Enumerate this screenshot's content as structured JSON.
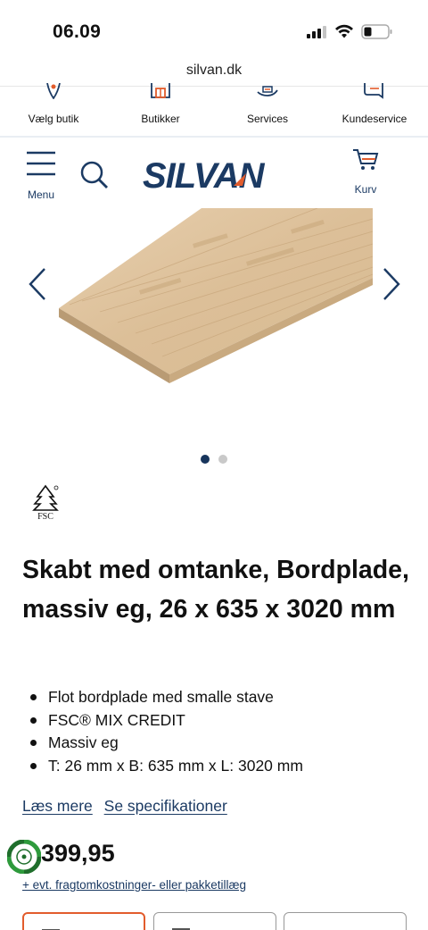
{
  "status_bar": {
    "time": "06.09"
  },
  "browser": {
    "url": "silvan.dk"
  },
  "top_nav": {
    "items": [
      {
        "label": "Vælg butik",
        "icon": "location-pin-icon"
      },
      {
        "label": "Butikker",
        "icon": "store-icon"
      },
      {
        "label": "Services",
        "icon": "services-icon"
      },
      {
        "label": "Kundeservice",
        "icon": "chat-icon"
      }
    ]
  },
  "header": {
    "menu_label": "Menu",
    "logo_text": "SILVAN",
    "cart_label": "Kurv"
  },
  "carousel": {
    "total_slides": 2,
    "active_slide": 1
  },
  "product": {
    "title": "Skabt med omtanke, Bordplade, massiv eg, 26 x 635 x 3020 mm",
    "bullets": [
      "Flot bordplade med smalle stave",
      "FSC® MIX CREDIT",
      "Massiv eg",
      "T: 26 mm x B: 635 mm x L: 3020 mm"
    ],
    "read_more": "Læs mere",
    "see_specs": "Se specifikationer",
    "price": "399,95",
    "freight_note": "+ evt. fragtomkostninger- eller pakketillæg",
    "certification": "FSC"
  },
  "colors": {
    "brand_navy": "#1b3a63",
    "accent_orange": "#e25c2c",
    "eco_green": "#2e9a3c"
  }
}
